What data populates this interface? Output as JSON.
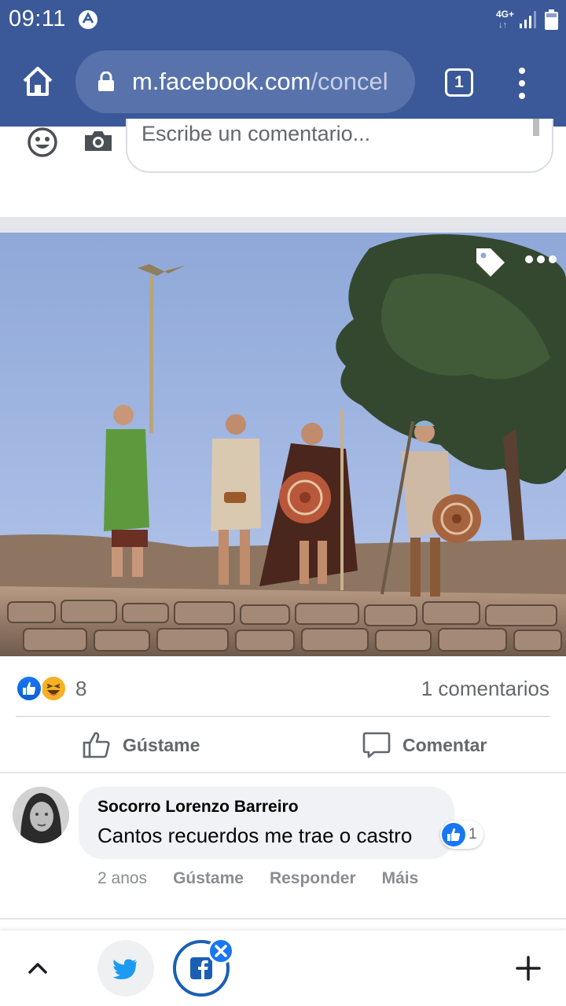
{
  "status_bar": {
    "time": "09:11",
    "network": "4G+",
    "network_arrows": "↓↑"
  },
  "browser": {
    "url_host": "m.facebook.com",
    "url_path": "/concel",
    "tab_count": "1"
  },
  "composer": {
    "placeholder": "Escribe un comentario..."
  },
  "post": {
    "reaction_count": "8",
    "comment_count": "1 comentarios",
    "like_label": "Gústame",
    "comment_label": "Comentar"
  },
  "comment": {
    "author": "Socorro Lorenzo Barreiro",
    "text": "Cantos recuerdos me trae o castro",
    "reaction_count": "1",
    "time": "2 anos",
    "like_link": "Gústame",
    "reply_link": "Responder",
    "more_link": "Máis"
  },
  "colors": {
    "facebook_blue": "#3b5998",
    "reaction_blue": "#1877f2",
    "gray_text": "#65676b"
  },
  "icons": [
    "home-icon",
    "lock-icon",
    "tabs-icon",
    "overflow-menu-icon",
    "emoji-icon",
    "camera-icon",
    "tag-icon",
    "more-icon",
    "like-icon",
    "comment-icon",
    "chevron-up-icon",
    "twitter-icon",
    "facebook-icon",
    "close-icon",
    "plus-icon"
  ]
}
